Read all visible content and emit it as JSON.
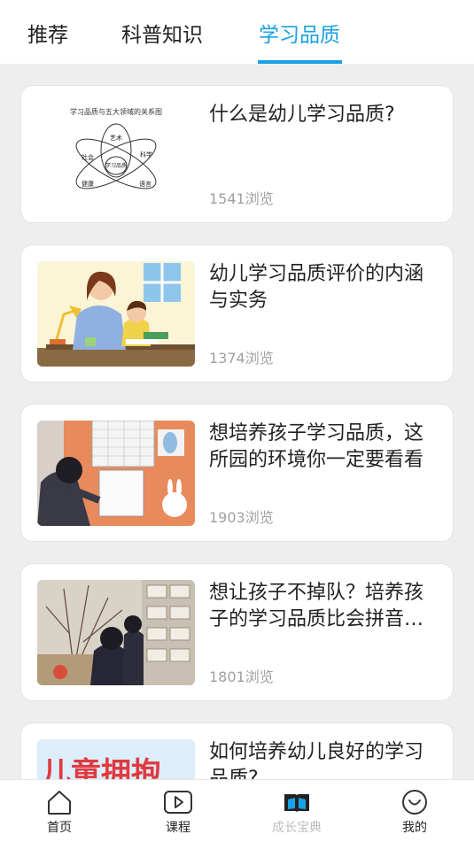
{
  "tabs": [
    {
      "label": "推荐"
    },
    {
      "label": "科普知识"
    },
    {
      "label": "学习品质"
    }
  ],
  "active_tab_index": 2,
  "accent_color": "#1aa1e6",
  "articles": [
    {
      "title": "什么是幼儿学习品质?",
      "views": "1541浏览",
      "thumb": {
        "type": "diagram",
        "caption": "学习品质与五大领域的关系图",
        "labels": [
          "艺术",
          "社会",
          "科学",
          "学习品质",
          "健康",
          "语言"
        ]
      }
    },
    {
      "title": "幼儿学习品质评价的内涵与实务",
      "views": "1374浏览",
      "thumb": {
        "type": "illustration-mother-child"
      }
    },
    {
      "title": "想培养孩子学习品质，这所园的环境你一定要看看",
      "views": "1903浏览",
      "thumb": {
        "type": "photo-classroom-wall"
      }
    },
    {
      "title": "想让孩子不掉队？培养孩子的学习品质比会拼音更重要",
      "views": "1801浏览",
      "thumb": {
        "type": "photo-kids-at-desk"
      }
    },
    {
      "title": "如何培养幼儿良好的学习品质?",
      "views": "",
      "thumb": {
        "type": "banner",
        "text": "儿童拥抱"
      }
    }
  ],
  "bottom_nav": [
    {
      "label": "首页",
      "icon": "home-icon"
    },
    {
      "label": "课程",
      "icon": "play-icon"
    },
    {
      "label": "成长宝典",
      "icon": "book-icon"
    },
    {
      "label": "我的",
      "icon": "smile-icon"
    }
  ],
  "active_nav_index": 2
}
